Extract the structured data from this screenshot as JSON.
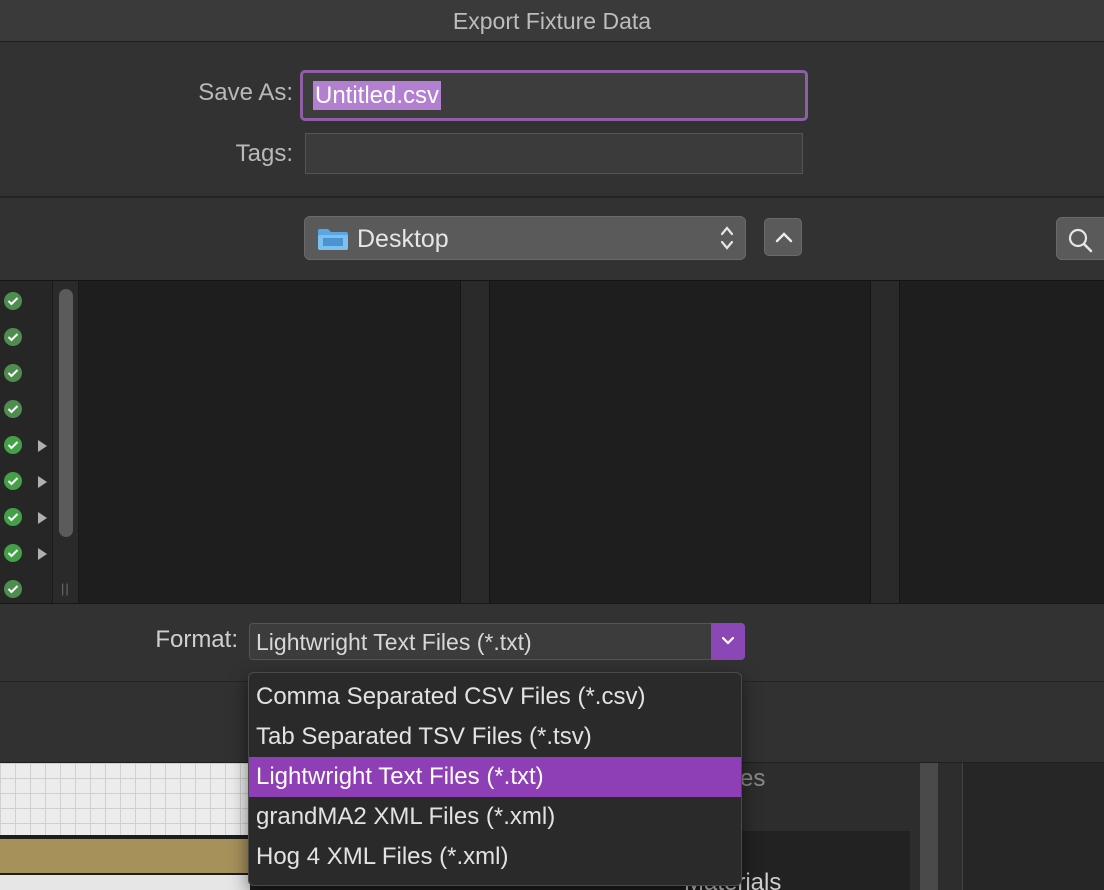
{
  "window": {
    "title": "Export Fixture Data"
  },
  "save_as": {
    "label": "Save As:",
    "value": "Untitled.csv"
  },
  "tags": {
    "label": "Tags:",
    "value": ""
  },
  "location": {
    "label": "Desktop",
    "icon": "folder-icon"
  },
  "sidebar": {
    "items": [
      {
        "status": "synced",
        "expandable": false
      },
      {
        "status": "synced",
        "expandable": false
      },
      {
        "status": "synced",
        "expandable": false
      },
      {
        "status": "synced",
        "expandable": false
      },
      {
        "status": "synced",
        "expandable": true
      },
      {
        "status": "synced",
        "expandable": true
      },
      {
        "status": "synced",
        "expandable": true
      },
      {
        "status": "synced",
        "expandable": true
      },
      {
        "status": "synced",
        "expandable": false
      }
    ]
  },
  "format": {
    "label": "Format:",
    "selected": "Lightwright Text Files (*.txt)",
    "options": [
      "Comma Separated CSV Files (*.csv)",
      "Tab Separated TSV Files (*.tsv)",
      "Lightwright Text Files (*.txt)",
      "grandMA2 XML Files (*.xml)",
      "Hog 4 XML Files (*.xml)"
    ],
    "selected_index": 2
  },
  "background": {
    "text_partial_1": "es",
    "text_partial_2": "Materials"
  },
  "colors": {
    "accent": "#8e3fb5",
    "selection": "#b27fd1",
    "status_green": "#4caf50"
  }
}
